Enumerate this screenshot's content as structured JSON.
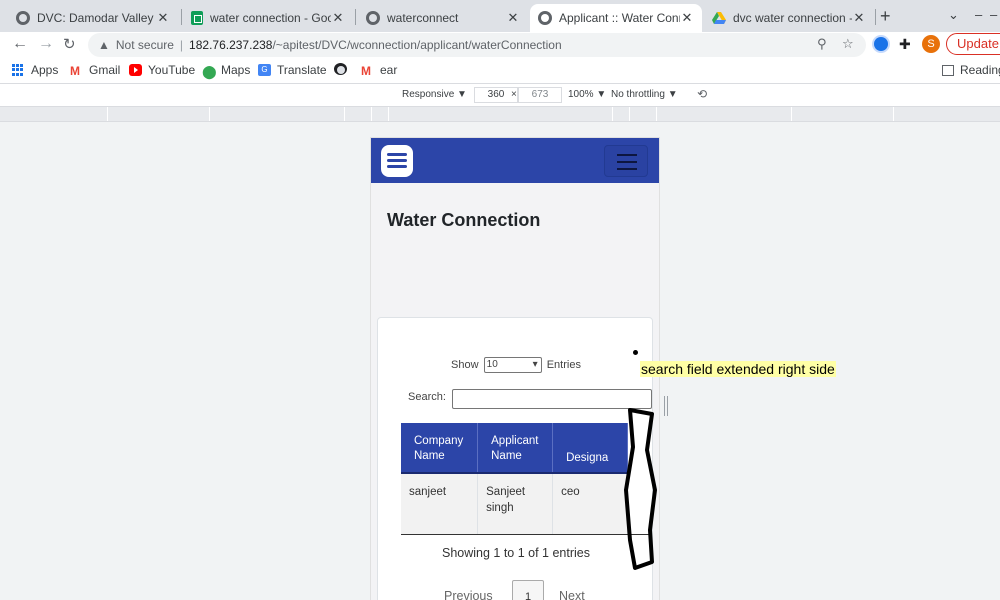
{
  "browser": {
    "tabs": [
      {
        "title": "DVC: Damodar Valley Corp",
        "icon": "globe-icon",
        "active": false
      },
      {
        "title": "water connection - Google",
        "icon": "sheets-icon",
        "active": false
      },
      {
        "title": "waterconnect",
        "icon": "globe-icon",
        "active": false
      },
      {
        "title": "Applicant :: Water Connec",
        "icon": "globe-icon",
        "active": true
      },
      {
        "title": "dvc water connection - Go",
        "icon": "drive-icon",
        "active": false
      }
    ],
    "tab_close": "✕",
    "new_tab": "+",
    "minimize": "–",
    "dropdown": "⌄",
    "address": {
      "security_label": "Not secure",
      "host": "182.76.237.238",
      "path": "/~apitest/DVC/wconnection/applicant/waterConnection"
    },
    "update_label": "Update",
    "profile_initial": "S",
    "bookmarks": [
      {
        "label": "Apps",
        "icon": "apps-grid-icon"
      },
      {
        "label": "Gmail",
        "icon": "gmail-icon"
      },
      {
        "label": "YouTube",
        "icon": "youtube-icon"
      },
      {
        "label": "Maps",
        "icon": "maps-icon"
      },
      {
        "label": "Translate",
        "icon": "translate-icon"
      },
      {
        "label": "",
        "icon": "globe-icon"
      },
      {
        "label": "ear",
        "icon": "gmail-icon"
      }
    ],
    "reading_list": "Reading"
  },
  "devtools": {
    "device": "Responsive ▼",
    "width": "360",
    "times": "×",
    "height": "673",
    "zoom": "100% ▼",
    "throttle": "No throttling ▼"
  },
  "app": {
    "page_title": "Water Connection",
    "datatable": {
      "show_label": "Show",
      "entries_value": "10",
      "entries_label": "Entries",
      "search_label": "Search:",
      "search_value": "",
      "columns": [
        [
          "Company",
          "Name"
        ],
        [
          "Applicant",
          "Name"
        ],
        [
          "Designa"
        ]
      ],
      "rows": [
        [
          [
            "sanjeet"
          ],
          [
            "Sanjeet",
            "singh"
          ],
          [
            "ceo"
          ]
        ]
      ],
      "info": "Showing 1 to 1 of 1 entries",
      "previous": "Previous",
      "current_page": "1",
      "next": "Next"
    }
  },
  "annotation": {
    "note": "search field extended right side",
    "highlight_color": "#ffffa5"
  }
}
